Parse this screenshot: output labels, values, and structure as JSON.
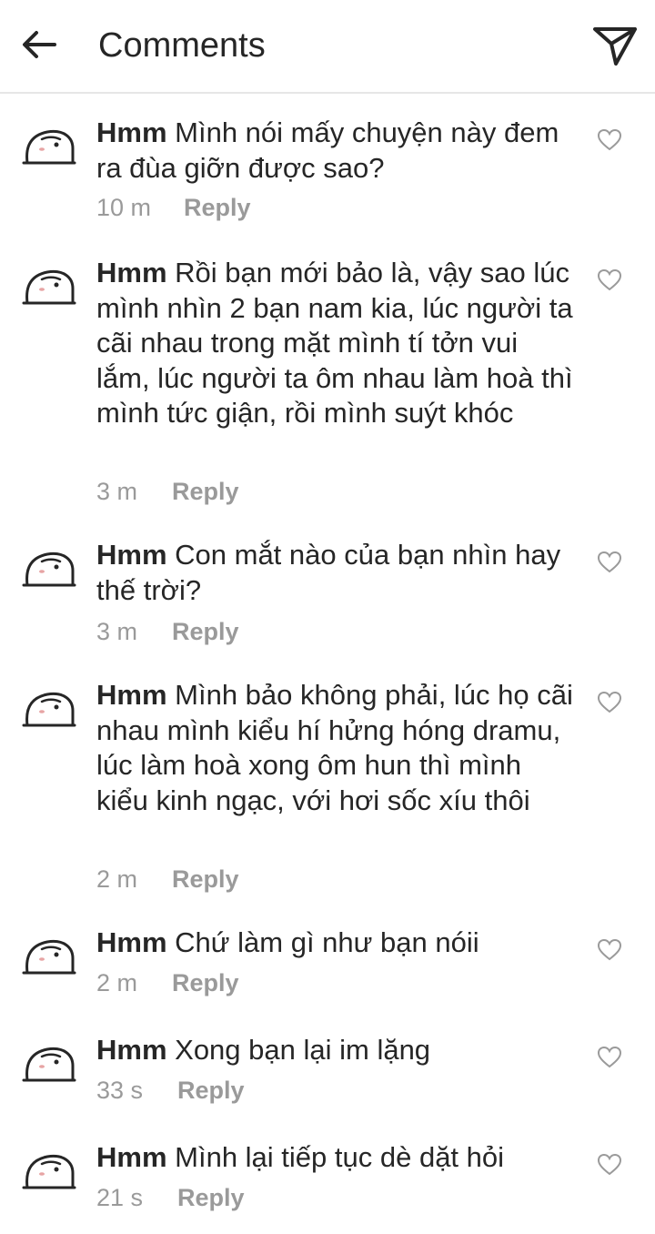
{
  "header": {
    "title": "Comments",
    "back_icon": "arrow-left-icon",
    "send_icon": "paper-plane-icon"
  },
  "colors": {
    "text": "#262626",
    "meta": "#9a9a9a",
    "divider": "#e6e6e6"
  },
  "comments": [
    {
      "username": "Hmm",
      "text": "Mình nói mấy chuyện này đem ra đùa giỡn được sao?",
      "time": "10 m",
      "reply": "Reply"
    },
    {
      "username": "Hmm",
      "text": "Rồi bạn mới bảo là, vậy sao lúc mình nhìn 2 bạn nam kia, lúc người ta cãi nhau trong mặt mình tí tởn vui lắm, lúc người ta ôm nhau làm hoà thì mình tức giận, rồi mình suýt khóc",
      "time": "3 m",
      "reply": "Reply"
    },
    {
      "username": "Hmm",
      "text": "Con mắt nào của bạn nhìn hay thế trời?",
      "time": "3 m",
      "reply": "Reply"
    },
    {
      "username": "Hmm",
      "text": "Mình bảo không phải, lúc họ cãi nhau mình kiểu hí hửng hóng dramu, lúc làm hoà xong ôm hun thì mình kiểu kinh ngạc, với hơi sốc xíu thôi",
      "time": "2 m",
      "reply": "Reply"
    },
    {
      "username": "Hmm",
      "text": "Chứ làm gì như bạn nóii",
      "time": "2 m",
      "reply": "Reply"
    },
    {
      "username": "Hmm",
      "text": "Xong bạn lại im lặng",
      "time": "33 s",
      "reply": "Reply"
    },
    {
      "username": "Hmm",
      "text": "Mình lại tiếp tục dè dặt hỏi",
      "time": "21 s",
      "reply": "Reply"
    }
  ]
}
